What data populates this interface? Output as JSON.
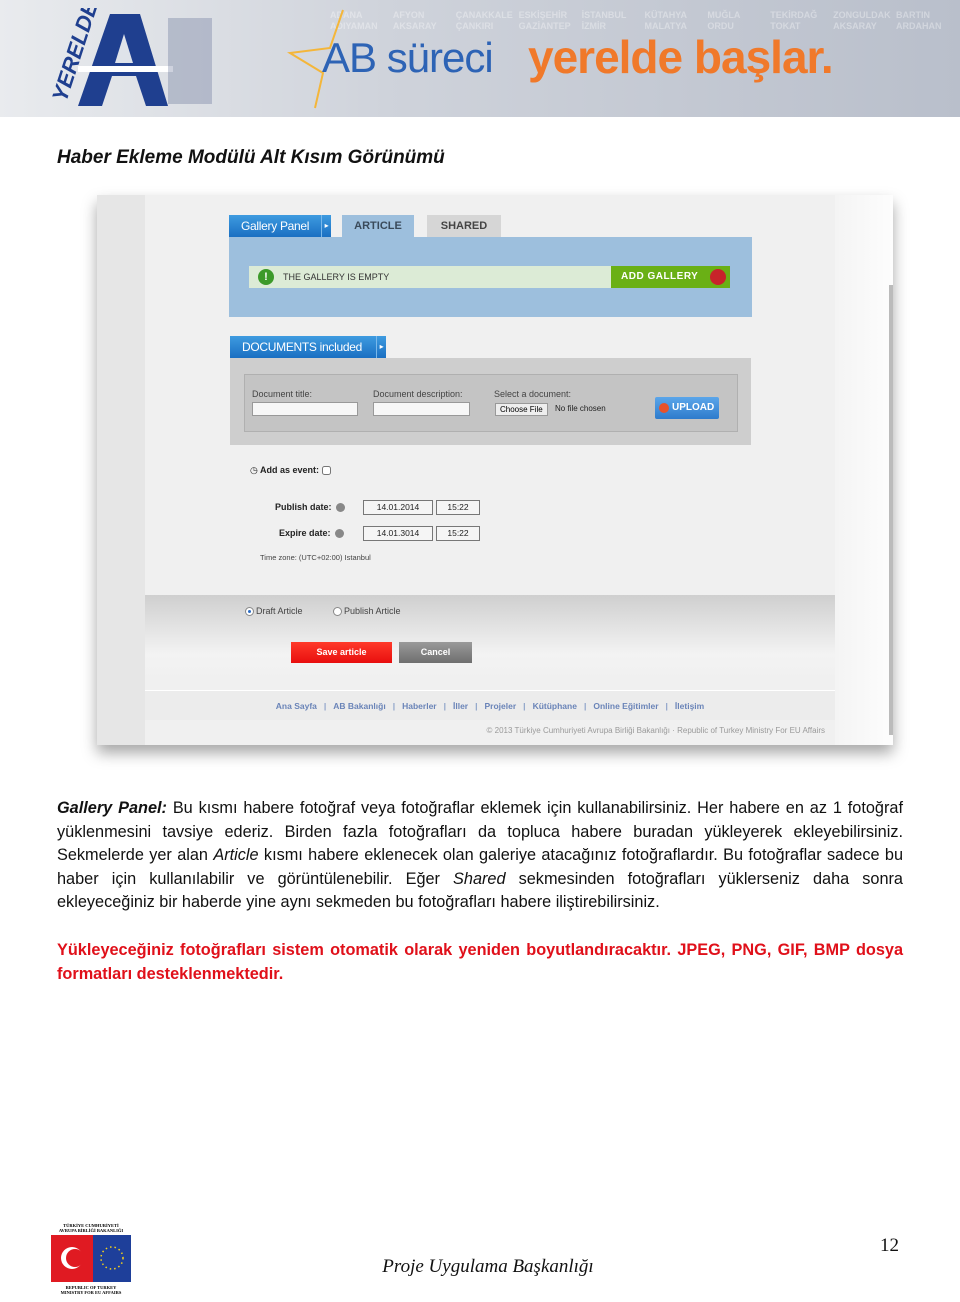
{
  "header": {
    "slogan_part1": "AB süreci",
    "slogan_part2": "yerelde başlar.",
    "logo_text": "YERELDE AB",
    "cities": [
      "ADANA",
      "ADIYAMAN",
      "AFYON",
      "AKSARAY",
      "ÇANAKKALE",
      "ÇANKIRI",
      "ESKİŞEHİR",
      "GAZİANTEP",
      "İSTANBUL",
      "İZMİR",
      "KÜTAHYA",
      "MALATYA",
      "MUĞLA",
      "ORDU",
      "TEKİRDAĞ",
      "TOKAT",
      "ZONGULDAK",
      "AKSARAY",
      "BARTIN",
      "ARDAHAN"
    ],
    "colors": {
      "blue": "#2d63b5",
      "orange": "#f0792a"
    }
  },
  "doc_title": "Haber Ekleme Modülü Alt Kısım Görünümü",
  "screenshot": {
    "gallery_tab": "Gallery Panel",
    "tabs": [
      "ARTICLE",
      "SHARED"
    ],
    "gallery_status": "THE GALLERY IS EMPTY",
    "add_gallery": "ADD GALLERY",
    "documents_tab": "DOCUMENTS included",
    "doc_title_label": "Document title:",
    "doc_desc_label": "Document description:",
    "select_doc_label": "Select a document:",
    "choose_file": "Choose File",
    "no_file": "No file chosen",
    "upload": "UPLOAD",
    "add_event": "Add as event:",
    "publish_label": "Publish date:",
    "publish_date": "14.01.2014",
    "publish_time": "15:22",
    "expire_label": "Expire date:",
    "expire_date": "14.01.3014",
    "expire_time": "15:22",
    "timezone": "Time zone: (UTC+02:00) Istanbul",
    "draft": "Draft Article",
    "publish": "Publish Article",
    "save": "Save article",
    "cancel": "Cancel",
    "nav": [
      "Ana Sayfa",
      "AB Bakanlığı",
      "Haberler",
      "İller",
      "Projeler",
      "Kütüphane",
      "Online Eğitimler",
      "İletişim"
    ],
    "copyright": "© 2013 Türkiye Cumhuriyeti Avrupa Birliği Bakanlığı · Republic of Turkey Ministry For EU Affairs"
  },
  "body": {
    "p1_term": "Gallery Panel:",
    "p1_a": " Bu kısmı habere fotoğraf veya fotoğraflar eklemek için kullanabilirsiniz. Her habere en az 1 fotoğraf yüklenmesini tavsiye ederiz. Birden fazla fotoğrafları da topluca habere buradan yükleyerek ekleyebilirsiniz. Sekmelerde yer alan ",
    "p1_article": "Article",
    "p1_b": " kısmı habere eklenecek olan galeriye atacağınız fotoğraflardır. Bu fotoğraflar sadece bu haber için kullanılabilir ve görüntülenebilir. Eğer ",
    "p1_shared": "Shared",
    "p1_c": " sekmesinden fotoğrafları yüklerseniz daha sonra ekleyeceğiniz bir haberde yine aynı sekmeden bu fotoğrafları habere iliştirebilirsiniz.",
    "warning": "Yükleyeceğiniz fotoğrafları sistem otomatik olarak yeniden boyutlandıracaktır. JPEG, PNG, GIF, BMP dosya formatları desteklenmektedir."
  },
  "footer": {
    "logo_top": "TÜRKİYE CUMHURİYETİ AVRUPA BİRLİĞİ BAKANLIĞI",
    "logo_bottom": "REPUBLIC OF TURKEY MINISTRY FOR EU AFFAIRS",
    "center": "Proje Uygulama Başkanlığı",
    "page_number": "12"
  }
}
